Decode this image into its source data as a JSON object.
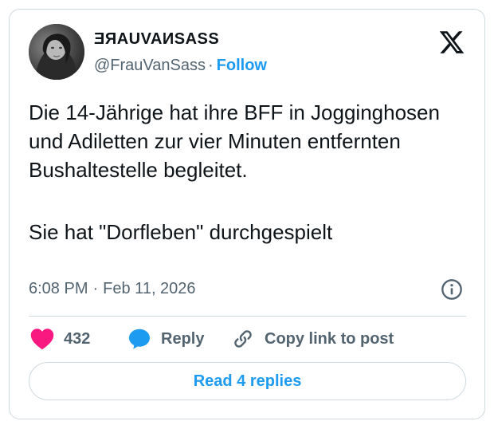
{
  "author": {
    "display_name": "ƎЯAUVAИSASS",
    "handle": "@FrauVanSass",
    "separator": "·",
    "follow_label": "Follow"
  },
  "icons": {
    "brand": "x-logo-icon",
    "info": "info-icon",
    "like": "heart-icon",
    "reply": "speech-bubble-icon",
    "copy": "link-icon"
  },
  "tweet": {
    "paragraphs": [
      "Die 14-Jährige hat ihre BFF in Jogginghosen und Adiletten zur vier Minuten entfernten Bushaltestelle begleitet.",
      "Sie hat \"Dorfleben\" durchgespielt"
    ]
  },
  "meta": {
    "time": "6:08 PM",
    "separator": "·",
    "date": "Feb 11, 2026"
  },
  "actions": {
    "like_count": "432",
    "reply_label": "Reply",
    "copy_label": "Copy link to post"
  },
  "footer": {
    "read_replies_label": "Read 4 replies"
  },
  "colors": {
    "accent": "#1d9bf0",
    "like": "#f91880",
    "text": "#0f1419",
    "muted": "#536471",
    "border": "#cfd9de"
  }
}
